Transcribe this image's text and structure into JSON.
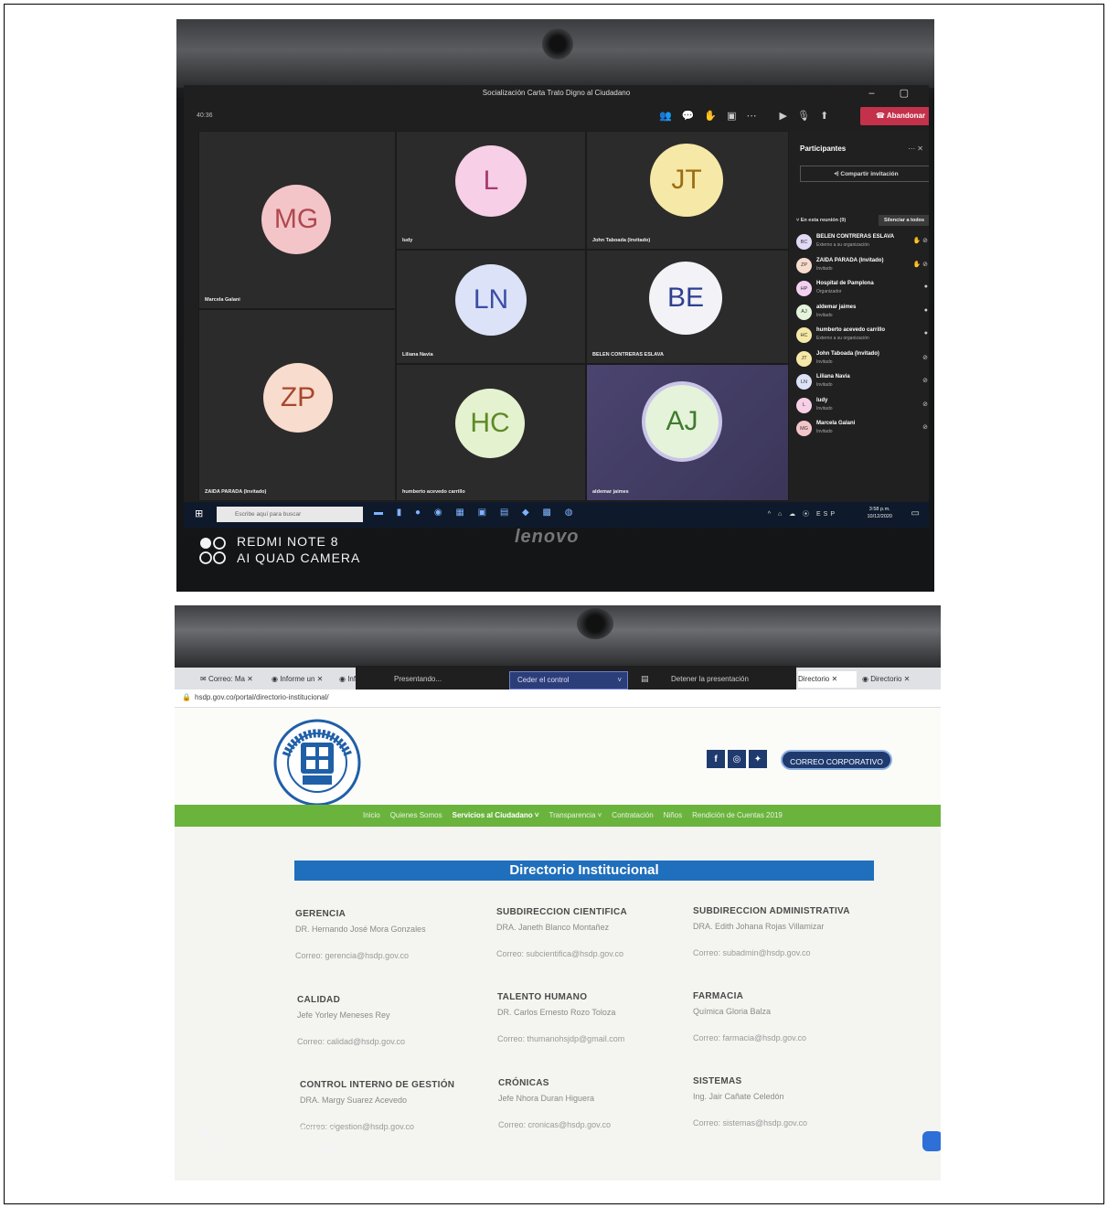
{
  "meeting": {
    "window_title": "Socialización Carta Trato Digno al Ciudadano",
    "timer": "40:36",
    "leave_label": "Abandonar",
    "tiles": [
      {
        "initials": "MG",
        "name": "Marcela Galani",
        "color": "#f4c5c8",
        "text": "#b0484f"
      },
      {
        "initials": "L",
        "name": "ludy",
        "color": "#f7cfe6",
        "text": "#a83a6c"
      },
      {
        "initials": "JT",
        "name": "John Taboada (Invitado)",
        "color": "#f6e8a6",
        "text": "#9b6d12"
      },
      {
        "initials": "LN",
        "name": "Liliana Navia",
        "color": "#dce3f8",
        "text": "#3b4ea5"
      },
      {
        "initials": "BE",
        "name": "BELEN CONTRERAS ESLAVA",
        "color": "#f2f2f7",
        "text": "#2e3f90"
      },
      {
        "initials": "ZP",
        "name": "ZAIDA PARADA (Invitado)",
        "color": "#f8dccd",
        "text": "#a8472d"
      },
      {
        "initials": "HC",
        "name": "humberto acevedo carrillo",
        "color": "#e5f2d0",
        "text": "#5e8a26"
      },
      {
        "initials": "AJ",
        "name": "aldemar jaimes",
        "color": "#e5f3da",
        "text": "#3f7b2e"
      }
    ],
    "panel": {
      "title": "Participantes",
      "invite_label": "Compartir invitación",
      "in_meeting_label": "En esta reunión (9)",
      "mute_all_label": "Silenciar a todos",
      "participants": [
        {
          "initials": "BC",
          "name": "BELEN CONTRERAS ESLAVA",
          "role": "Externo a su organización",
          "color": "#e3d9f7"
        },
        {
          "initials": "ZP",
          "name": "ZAIDA PARADA (Invitado)",
          "role": "Invitado",
          "color": "#f8dccd"
        },
        {
          "initials": "HP",
          "name": "Hospital de Pamplona",
          "role": "Organizador",
          "color": "#f4d0f0"
        },
        {
          "initials": "AJ",
          "name": "aldemar jaimes",
          "role": "Invitado",
          "color": "#e5f3da"
        },
        {
          "initials": "HC",
          "name": "humberto acevedo carrillo",
          "role": "Externo a su organización",
          "color": "#f6e8a6"
        },
        {
          "initials": "JT",
          "name": "John Taboada (Invitado)",
          "role": "Invitado",
          "color": "#f6e8a6"
        },
        {
          "initials": "LN",
          "name": "Liliana Navia",
          "role": "Invitado",
          "color": "#dce3f8"
        },
        {
          "initials": "L",
          "name": "ludy",
          "role": "Invitado",
          "color": "#f7cfe6"
        },
        {
          "initials": "MG",
          "name": "Marcela Galani",
          "role": "Invitado",
          "color": "#f4c5c8"
        }
      ]
    },
    "taskbar": {
      "search_placeholder": "Escribe aquí para buscar",
      "lang": "ESP",
      "time": "3:58 p.m.",
      "date": "10/12/2020"
    },
    "brand": "lenovo"
  },
  "camera_tag": {
    "line1": "REDMI NOTE 8",
    "line2": "AI QUAD CAMERA"
  },
  "website": {
    "tabs": [
      "Correo: Ma",
      "Informe un",
      "Inforn",
      "Directorio",
      "Directorio"
    ],
    "share_bar": {
      "presenting": "Presentando...",
      "cede_control": "Ceder el control",
      "stop": "Detener la presentación"
    },
    "url": "hsdp.gov.co/portal/directorio-institucional/",
    "corp_mail_button": "CORREO CORPORATIVO",
    "nav": [
      "Inicio",
      "Quienes Somos",
      "Servicios al Ciudadano",
      "Transparencia",
      "Contratación",
      "Niños",
      "Rendición de Cuentas 2019"
    ],
    "directory_title": "Directorio Institucional",
    "departments": [
      {
        "name": "GERENCIA",
        "head": "DR. Hernando José Mora Gonzales",
        "mail": "Correo: gerencia@hsdp.gov.co"
      },
      {
        "name": "SUBDIRECCION CIENTIFICA",
        "head": "DRA. Janeth Blanco Montañez",
        "mail": "Correo: subcientifica@hsdp.gov.co"
      },
      {
        "name": "SUBDIRECCION ADMINISTRATIVA",
        "head": "DRA. Edith Johana Rojas Villamizar",
        "mail": "Correo: subadmin@hsdp.gov.co"
      },
      {
        "name": "CALIDAD",
        "head": "Jefe Yorley Meneses Rey",
        "mail": "Correo: calidad@hsdp.gov.co"
      },
      {
        "name": "TALENTO HUMANO",
        "head": "DR. Carlos Ernesto Rozo Toloza",
        "mail": "Correo: thumanohsjdp@gmail.com"
      },
      {
        "name": "FARMACIA",
        "head": "Química Gloria Balza",
        "mail": "Correo: farmacia@hsdp.gov.co"
      },
      {
        "name": "CONTROL INTERNO DE GESTIÓN",
        "head": "DRA. Margy Suarez Acevedo",
        "mail": "Correo: cigestion@hsdp.gov.co"
      },
      {
        "name": "CRÓNICAS",
        "head": "Jefe Nhora Duran Higuera",
        "mail": "Correo: cronicas@hsdp.gov.co"
      },
      {
        "name": "SISTEMAS",
        "head": "Ing. Jair Cañate Celedón",
        "mail": "Correo: sistemas@hsdp.gov.co"
      }
    ]
  }
}
